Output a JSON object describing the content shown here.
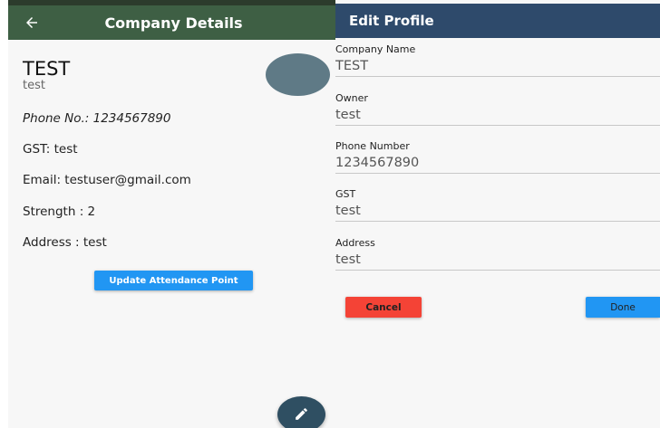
{
  "left": {
    "appbar_title": "Company Details",
    "company_name": "TEST",
    "company_subtitle": "test",
    "phone": "Phone No.: 1234567890",
    "gst": "GST: test",
    "email": "Email: testuser@gmail.com",
    "strength": "Strength : 2",
    "address": "Address : test",
    "update_button_label": "Update Attendance Point",
    "icons": {
      "back": "arrow-left-icon",
      "fab": "pencil-icon"
    }
  },
  "right": {
    "appbar_title": "Edit Profile",
    "fields": [
      {
        "label": "Company Name",
        "value": "TEST"
      },
      {
        "label": "Owner",
        "value": "test"
      },
      {
        "label": "Phone Number",
        "value": "1234567890"
      },
      {
        "label": "GST",
        "value": "test"
      },
      {
        "label": "Address",
        "value": "test"
      }
    ],
    "cancel_label": "Cancel",
    "done_label": "Done"
  },
  "colors": {
    "left_appbar": "#3e5f44",
    "right_appbar": "#2e4a6b",
    "primary_button": "#2196f3",
    "cancel_button": "#f44336",
    "avatar": "#5f7a86",
    "fab": "#2f4f62"
  }
}
